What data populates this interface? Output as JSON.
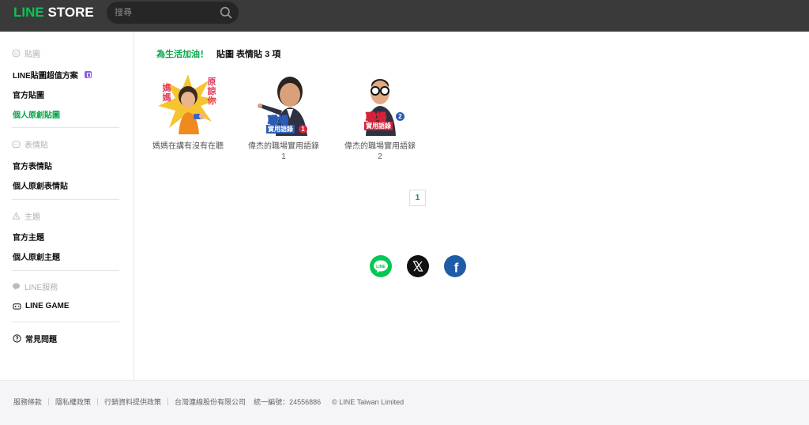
{
  "header": {
    "logo_line": "LINE",
    "logo_store": " STORE",
    "search_placeholder": "搜尋"
  },
  "sidebar": {
    "sections": [
      {
        "title": "貼圖",
        "items": [
          "LINE貼圖超值方案",
          "官方貼圖",
          "個人原創貼圖"
        ]
      },
      {
        "title": "表情貼",
        "items": [
          "官方表情貼",
          "個人原創表情貼"
        ]
      },
      {
        "title": "主題",
        "items": [
          "官方主題",
          "個人原創主題"
        ]
      },
      {
        "title": "LINE服務",
        "items": [
          "LINE GAME"
        ]
      },
      {
        "title": "",
        "items": [
          "常見問題"
        ]
      }
    ],
    "active_item": "個人原創貼圖"
  },
  "main": {
    "search_term": "為生活加油！",
    "result_summary": "貼圖 表情貼 3 項",
    "products": [
      {
        "name": "媽媽在講有沒有在聽",
        "sticker_text_left": "媽媽",
        "sticker_text_right": "原諒你"
      },
      {
        "name": "偉杰的職場實用語錄1",
        "sticker_text": "職場",
        "sticker_sub": "實用語錄",
        "sticker_num": "1"
      },
      {
        "name": "偉杰的職場實用語錄2",
        "sticker_text": "職場",
        "sticker_sub": "實用語錄",
        "sticker_num": "2"
      }
    ],
    "pagination": {
      "current": "1"
    }
  },
  "social": {
    "line_label": "LINE",
    "x_label": "𝕏",
    "facebook_label": "f"
  },
  "footer": {
    "links": [
      "服務條款",
      "隱私權政策",
      "行銷資料提供政策",
      "台灣連線股份有限公司"
    ],
    "tax_id": "統一編號：24556886",
    "copyright": "© LINE Taiwan Limited"
  },
  "colors": {
    "brand_green": "#06c755",
    "active_green": "#06a447",
    "header_bg": "#3a3a3a",
    "facebook_blue": "#1877f2"
  }
}
